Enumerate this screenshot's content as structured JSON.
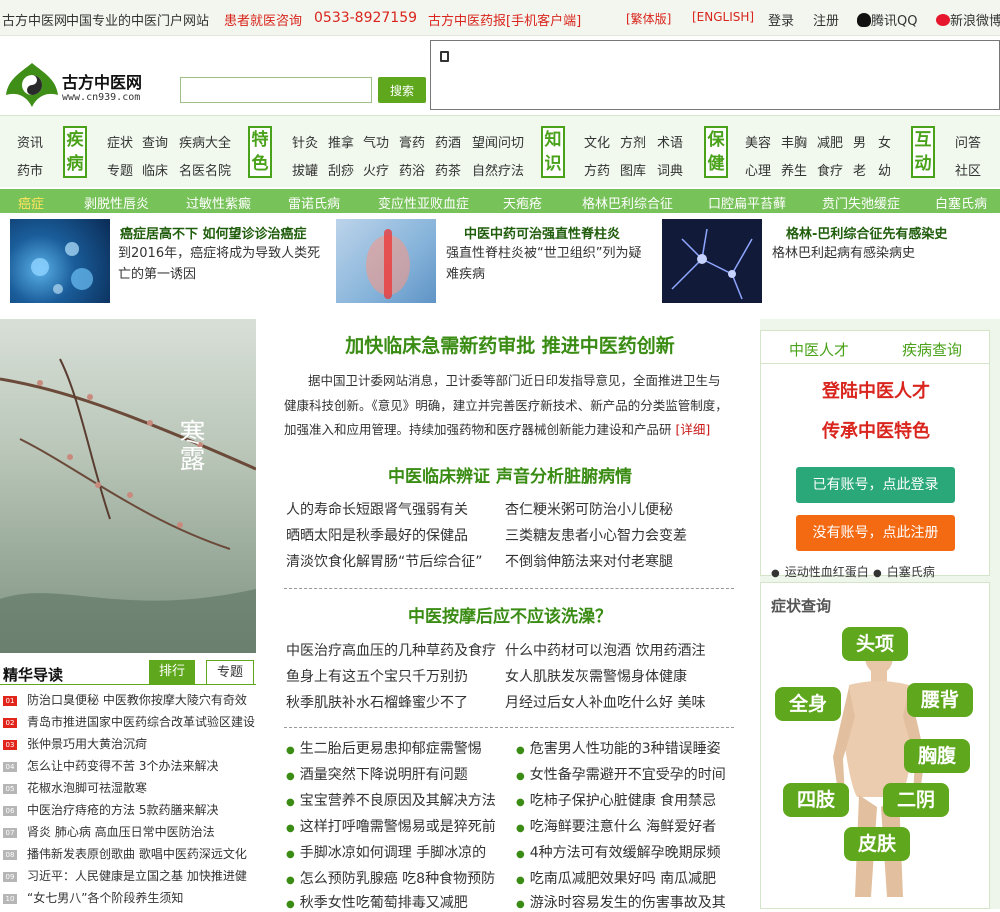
{
  "topbar": {
    "site_name": "古方中医网",
    "tagline": "中国专业的中医门户网站",
    "consult": "患者就医咨询",
    "phone": "0533-8927159",
    "newspaper": "古方中医药报[手机客户端]",
    "traditional": "[繁体版]",
    "english": "[ENGLISH]",
    "login": "登录",
    "register": "注册",
    "qq": "腾讯QQ",
    "weibo": "新浪微博"
  },
  "header": {
    "logo_cn": "古方中医网",
    "logo_url": "www.cn939.com",
    "search_placeholder": "",
    "search_button": "搜索"
  },
  "nav": {
    "groups": [
      {
        "badge": "疾病",
        "links": [
          "资讯",
          "药市"
        ]
      },
      {
        "badge": "疾病",
        "links": [
          "症状",
          "查询",
          "疾病大全",
          "专题",
          "临床",
          "名医名院"
        ]
      },
      {
        "badge": "特色",
        "links": [
          "针灸",
          "推拿",
          "气功",
          "膏药",
          "药酒",
          "望闻问切",
          "拔罐",
          "刮痧",
          "火疗",
          "药浴",
          "药茶",
          "自然疗法"
        ]
      },
      {
        "badge": "知识",
        "links": [
          "文化",
          "方剂",
          "术语",
          "方药",
          "图库",
          "词典"
        ]
      },
      {
        "badge": "保健",
        "links": [
          "美容",
          "丰胸",
          "减肥",
          "男",
          "女",
          "心理",
          "养生",
          "食疗",
          "老",
          "幼"
        ]
      },
      {
        "badge": "互动",
        "links": [
          "问答",
          "社区"
        ]
      }
    ],
    "left_links": [
      "资讯",
      "药市"
    ],
    "disease_links": [
      "症状",
      "查询",
      "疾病大全",
      "专题",
      "临床",
      "名医名院"
    ],
    "feature_links": [
      "针灸",
      "推拿",
      "气功",
      "膏药",
      "药酒",
      "望闻问切",
      "拔罐",
      "刮痧",
      "火疗",
      "药浴",
      "药茶",
      "自然疗法"
    ],
    "knowledge_links": [
      "文化",
      "方剂",
      "术语",
      "方药",
      "图库",
      "词典"
    ],
    "health_links": [
      "美容",
      "丰胸",
      "减肥",
      "男",
      "女",
      "心理",
      "养生",
      "食疗",
      "老",
      "幼"
    ],
    "interact_links": [
      "问答",
      "社区"
    ],
    "badges": [
      "疾病",
      "特色",
      "知识",
      "保健",
      "互动"
    ]
  },
  "ticker": [
    "癌症",
    "剥脱性唇炎",
    "过敏性紫癜",
    "雷诺氏病",
    "变应性亚败血症",
    "天疱疮",
    "格林巴利综合征",
    "口腔扁平苔藓",
    "贲门失弛缓症",
    "白塞氏病"
  ],
  "promos": [
    {
      "title": "癌症居高不下 如何望诊诊治癌症",
      "text": "到2016年，癌症将成为导致人类死亡的第一诱因"
    },
    {
      "title": "中医中药可治强直性脊柱炎",
      "text": "强直性脊柱炎被“世卫组织”列为疑难疾病"
    },
    {
      "title": "格林-巴利综合征先有感染史",
      "text": "格林巴利起病有感染病史"
    }
  ],
  "left": {
    "image_text": "寒露",
    "title": "精华导读",
    "tab_rank": "排行",
    "tab_topic": "专题",
    "items": [
      {
        "n": "01",
        "t": "防治口臭便秘 中医教你按摩大陵穴有奇效"
      },
      {
        "n": "02",
        "t": "青岛市推进国家中医药综合改革试验区建设"
      },
      {
        "n": "03",
        "t": "张仲景巧用大黄治沉疴"
      },
      {
        "n": "04",
        "t": "怎么让中药变得不苦 3个办法来解决"
      },
      {
        "n": "05",
        "t": "花椒水泡脚可祛湿散寒"
      },
      {
        "n": "06",
        "t": "中医治疗痔疮的方法 5款药膳来解决"
      },
      {
        "n": "07",
        "t": "肾炎 肺心病 高血压日常中医防治法"
      },
      {
        "n": "08",
        "t": "播伟新发表原创歌曲 歌唱中医药深远文化"
      },
      {
        "n": "09",
        "t": "习近平：人民健康是立国之基 加快推进健"
      },
      {
        "n": "10",
        "t": "“女七男八”各个阶段养生须知"
      }
    ]
  },
  "center": {
    "headline": "加快临床急需新药审批 推进中医药创新",
    "paragraph": "据中国卫计委网站消息，卫计委等部门近日印发指导意见，全面推进卫生与健康科技创新。《意见》明确，建立并完善医疗新技术、新产品的分类监管制度，加强准入和应用管理。持续加强药物和医疗器械创新能力建设和产品研",
    "detail": "[详细]",
    "section1": "中医临床辨证 声音分析脏腑病情",
    "links1": [
      "人的寿命长短跟肾气强弱有关",
      "杏仁粳米粥可防治小儿便秘",
      "晒晒太阳是秋季最好的保健品",
      "三类糖友患者小心智力会变差",
      "清淡饮食化解胃肠“节后综合征”",
      "不倒翁伸筋法来对付老寒腿"
    ],
    "section2": "中医按摩后应不应该洗澡？",
    "links2": [
      "中医治疗高血压的几种草药及食疗",
      "什么中药材可以泡酒 饮用药酒注",
      "鱼身上有这五个宝只千万别扔",
      "女人肌肤发灰需警惕身体健康",
      "秋季肌肤补水石榴蜂蜜少不了",
      "月经过后女人补血吃什么好 美味"
    ],
    "links3": [
      "生二胎后更易患抑郁症需警惕",
      "危害男人性功能的3种错误睡姿",
      "酒量突然下降说明肝有问题",
      "女性备孕需避开不宜受孕的时间",
      "宝宝营养不良原因及其解决方法",
      "吃柿子保护心脏健康 食用禁忌",
      "这样打呼噜需警惕易或是猝死前",
      "吃海鲜要注意什么 海鲜爱好者",
      "手脚冰凉如何调理 手脚冰凉的",
      "4种方法可有效缓解孕晚期尿频",
      "怎么预防乳腺癌 吃8种食物预防",
      "吃南瓜减肥效果好吗 南瓜减肥",
      "秋季女性吃葡萄排毒又减肥",
      "游泳时容易发生的伤害事故及其"
    ]
  },
  "right": {
    "tab1": "中医人才",
    "tab2": "疾病查询",
    "big1": "登陆中医人才",
    "big2": "传承中医特色",
    "login_button": "已有账号，点此登录",
    "register_button": "没有账号，点此注册",
    "small1": "运动性血红蛋白",
    "small2": "白塞氏病",
    "symptom_title": "症状查询",
    "symptoms": [
      "头项",
      "全身",
      "腰背",
      "胸腹",
      "四肢",
      "二阴",
      "皮肤"
    ]
  }
}
